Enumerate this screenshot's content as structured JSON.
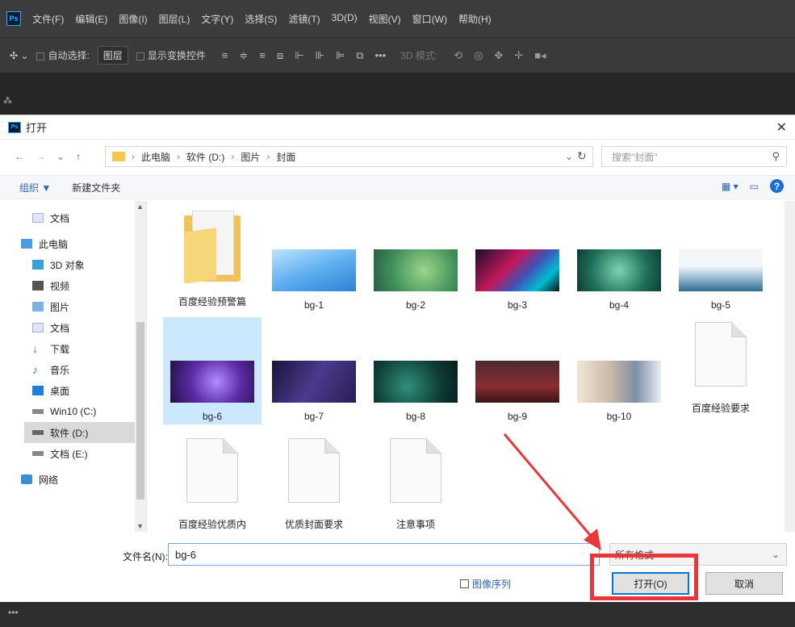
{
  "ps": {
    "logo": "Ps",
    "menu": [
      "文件(F)",
      "编辑(E)",
      "图像(I)",
      "图层(L)",
      "文字(Y)",
      "选择(S)",
      "滤镜(T)",
      "3D(D)",
      "视图(V)",
      "窗口(W)",
      "帮助(H)"
    ],
    "options": {
      "auto_select": "自动选择:",
      "layer_select": "图层",
      "show_transform": "显示变换控件",
      "mode_3d": "3D 模式:"
    },
    "bottom_dots": "•••"
  },
  "dialog": {
    "title": "打开",
    "address": [
      "此电脑",
      "软件 (D:)",
      "图片",
      "封面"
    ],
    "search_placeholder": "搜索\"封面\"",
    "toolbar": {
      "organize": "组织 ▼",
      "new_folder": "新建文件夹"
    },
    "sidebar": [
      {
        "label": "文档",
        "icon": "document-icon"
      },
      {
        "label": "此电脑",
        "icon": "computer-icon"
      },
      {
        "label": "3D 对象",
        "icon": "cube-icon"
      },
      {
        "label": "视频",
        "icon": "video-icon"
      },
      {
        "label": "图片",
        "icon": "picture-icon"
      },
      {
        "label": "文档",
        "icon": "document-icon"
      },
      {
        "label": "下载",
        "icon": "download-icon"
      },
      {
        "label": "音乐",
        "icon": "music-icon"
      },
      {
        "label": "桌面",
        "icon": "desktop-icon"
      },
      {
        "label": "Win10 (C:)",
        "icon": "drive-icon"
      },
      {
        "label": "软件 (D:)",
        "icon": "drive-icon"
      },
      {
        "label": "文档 (E:)",
        "icon": "drive-icon"
      },
      {
        "label": "网络",
        "icon": "network-icon"
      }
    ],
    "files": [
      {
        "label": "百度经验预警篇",
        "kind": "folder"
      },
      {
        "label": "bg-1",
        "kind": "image"
      },
      {
        "label": "bg-2",
        "kind": "image"
      },
      {
        "label": "bg-3",
        "kind": "image"
      },
      {
        "label": "bg-4",
        "kind": "image"
      },
      {
        "label": "bg-5",
        "kind": "image"
      },
      {
        "label": "bg-6",
        "kind": "image",
        "selected": true
      },
      {
        "label": "bg-7",
        "kind": "image"
      },
      {
        "label": "bg-8",
        "kind": "image"
      },
      {
        "label": "bg-9",
        "kind": "image"
      },
      {
        "label": "bg-10",
        "kind": "image"
      },
      {
        "label": "百度经验要求",
        "kind": "doc"
      },
      {
        "label": "百度经验优质内",
        "kind": "doc"
      },
      {
        "label": "优质封面要求",
        "kind": "doc"
      },
      {
        "label": "注意事项",
        "kind": "doc"
      }
    ],
    "filename_label": "文件名(N):",
    "filename_value": "bg-6",
    "filetype": "所有格式",
    "image_sequence": "图像序列",
    "open_button": "打开(O)",
    "cancel_button": "取消"
  },
  "colors": {
    "highlight": "#e8363a",
    "selection": "#cce8ff",
    "link": "#2d64b3"
  }
}
